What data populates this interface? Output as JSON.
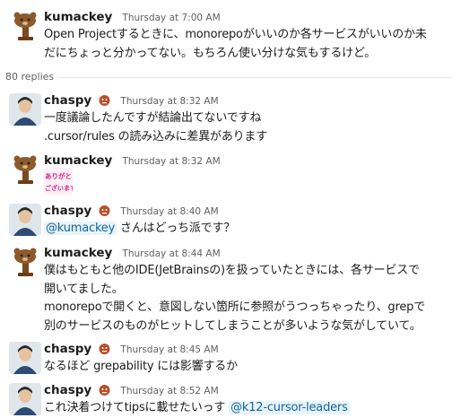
{
  "thread": {
    "replies_label": "80 replies",
    "messages": [
      {
        "author": "kumackey",
        "time": "Thursday at 7:00 AM",
        "lines": [
          "Open Projectするときに、monorepoがいいのか各サービスがいいのか未",
          "だにちょっと分かってない。もちろん使い分けな気もするけど。"
        ]
      },
      {
        "author": "chaspy",
        "time": "Thursday at 8:32 AM",
        "lines": [
          "一度議論したんですが結論出てないですね",
          ".cursor/rules の読み込みに差異があります"
        ]
      },
      {
        "author": "kumackey",
        "time": "Thursday at 8:32 AM",
        "sticker_text_1": "ありがとう",
        "sticker_text_2": "ございます!"
      },
      {
        "author": "chaspy",
        "time": "Thursday at 8:40 AM",
        "mention": "@kumackey",
        "text_after": " さんはどっち派です？"
      },
      {
        "author": "kumackey",
        "time": "Thursday at 8:44 AM",
        "lines": [
          "僕はもともと他のIDE(JetBrainsの)を扱っていたときには、各サービスで",
          "開いてました。",
          "monorepoで開くと、意図しない箇所に参照がうつっちゃったり、grepで",
          "別のサービスのものがヒットしてしまうことが多いような気がしていて。"
        ]
      },
      {
        "author": "chaspy",
        "time": "Thursday at 8:45 AM",
        "lines": [
          "なるほど grepability には影響するか"
        ]
      },
      {
        "author": "chaspy",
        "time": "Thursday at 8:52 AM",
        "text_before": "これ決着つけてtipsに載せたいっす ",
        "mention": "@k12-cursor-leaders"
      }
    ]
  },
  "colors": {
    "text": "#1d1c1d",
    "timestamp": "#616061",
    "mention_bg": "#e8f4fb",
    "mention_fg": "#1264a3"
  }
}
